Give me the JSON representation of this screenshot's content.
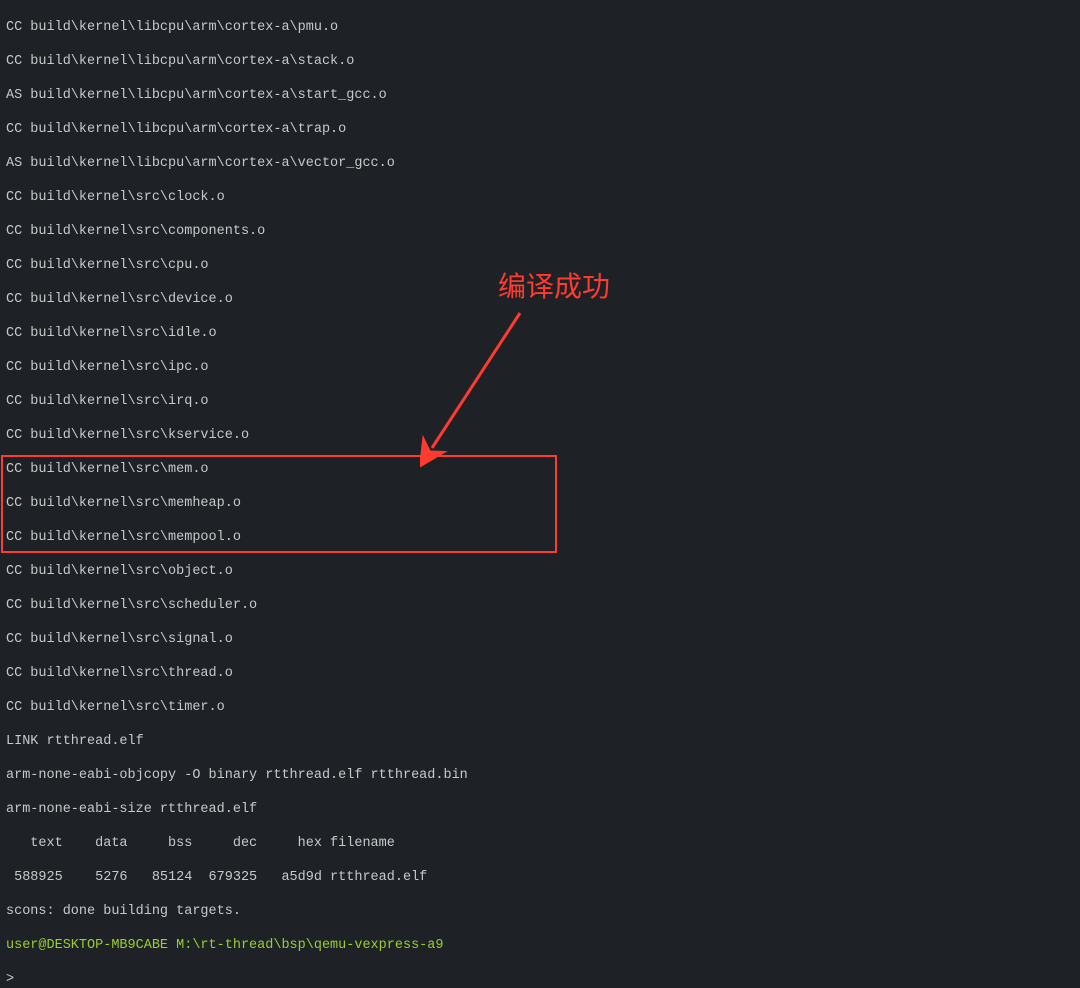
{
  "compile_lines": [
    "CC build\\kernel\\libcpu\\arm\\cortex-a\\pmu.o",
    "CC build\\kernel\\libcpu\\arm\\cortex-a\\stack.o",
    "AS build\\kernel\\libcpu\\arm\\cortex-a\\start_gcc.o",
    "CC build\\kernel\\libcpu\\arm\\cortex-a\\trap.o",
    "AS build\\kernel\\libcpu\\arm\\cortex-a\\vector_gcc.o",
    "CC build\\kernel\\src\\clock.o",
    "CC build\\kernel\\src\\components.o",
    "CC build\\kernel\\src\\cpu.o",
    "CC build\\kernel\\src\\device.o",
    "CC build\\kernel\\src\\idle.o",
    "CC build\\kernel\\src\\ipc.o",
    "CC build\\kernel\\src\\irq.o",
    "CC build\\kernel\\src\\kservice.o",
    "CC build\\kernel\\src\\mem.o",
    "CC build\\kernel\\src\\memheap.o",
    "CC build\\kernel\\src\\mempool.o",
    "CC build\\kernel\\src\\object.o",
    "CC build\\kernel\\src\\scheduler.o",
    "CC build\\kernel\\src\\signal.o",
    "CC build\\kernel\\src\\thread.o",
    "CC build\\kernel\\src\\timer.o",
    "LINK rtthread.elf"
  ],
  "result_lines": [
    "arm-none-eabi-objcopy -O binary rtthread.elf rtthread.bin",
    "arm-none-eabi-size rtthread.elf",
    "   text    data     bss     dec     hex filename",
    " 588925    5276   85124  679325   a5d9d rtthread.elf",
    "scons: done building targets."
  ],
  "prompt_line": "user@DESKTOP-MB9CABE M:\\rt-thread\\bsp\\qemu-vexpress-a9",
  "prompt_symbol": "> ",
  "annotation_text": "编译成功",
  "colors": {
    "background": "#1e2227",
    "text": "#c8c8c8",
    "prompt": "#9acd32",
    "annotation": "#ff3b30"
  }
}
